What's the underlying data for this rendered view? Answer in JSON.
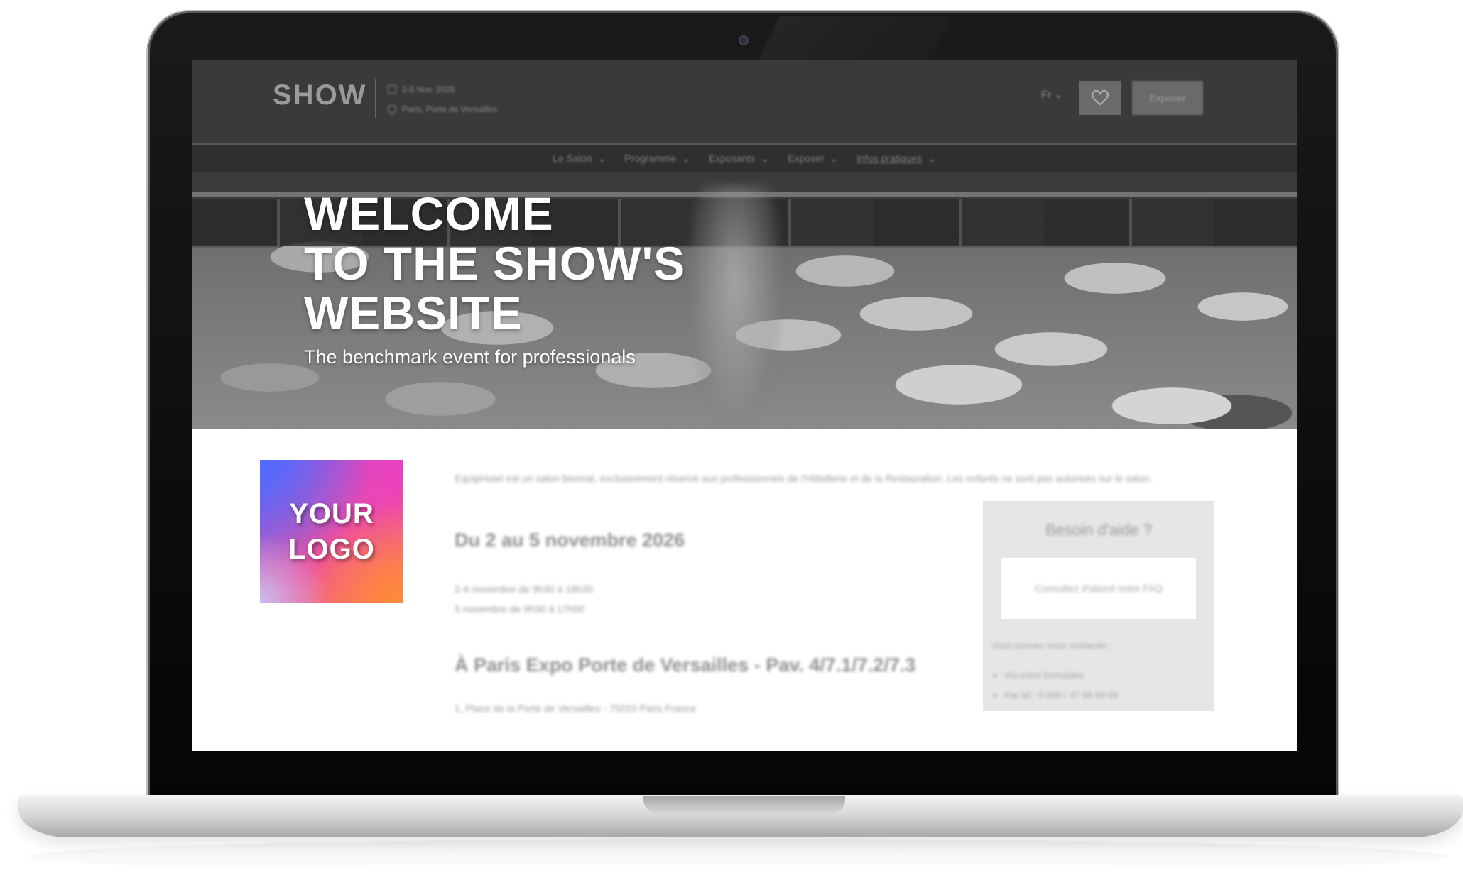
{
  "site": {
    "brand": "SHOW",
    "event_dates": "2-5 Nov. 2026",
    "event_location": "Paris, Porte de Versailles",
    "language": "Fr",
    "exhibit_button": "Exposer"
  },
  "nav": {
    "items": [
      {
        "label": "Le Salon"
      },
      {
        "label": "Programme"
      },
      {
        "label": "Exposants"
      },
      {
        "label": "Exposer"
      },
      {
        "label": "Infos pratiques"
      }
    ]
  },
  "hero": {
    "title_line1": "WELCOME",
    "title_line2": "TO THE SHOW'S",
    "title_line3": "WEBSITE",
    "subtitle": "The benchmark event for professionals"
  },
  "logo": {
    "line1": "YOUR",
    "line2": "LOGO"
  },
  "content": {
    "intro": "EquipHotel est un salon biennal, exclusivement réservé aux professionnels de l'Hôtellerie et de la Restauration. Les enfants ne sont pas autorisés sur le salon.",
    "dates_title": "Du 2 au 5 novembre 2026",
    "hours_line1": "2-4 novembre de 9h30 à 18h30",
    "hours_line2": "5 novembre de 9h30 à 17h00",
    "venue_title": "À Paris Expo Porte de Versailles - Pav. 4/7.1/7.2/7.3",
    "address": "1, Place de la Porte de Versailles - 75015 Paris France"
  },
  "help": {
    "title": "Besoin d'aide ?",
    "faq": "Consultez d'abord notre FAQ",
    "contact_label": "Vous pouvez nous contacter :",
    "contact_form": "Via notre formulaire",
    "contact_phone": "Par tel : 0 800 / 47 98 89 09"
  },
  "icons": {
    "favorite": "heart-icon",
    "calendar": "calendar-icon",
    "location": "pin-icon",
    "dropdown": "chevron-down-icon",
    "webcam": "webcam"
  },
  "colors": {
    "header_bg": "#3a3a3a",
    "nav_bg": "#2f2f2f",
    "hero_text": "#ffffff",
    "logo_gradient_start": "#7a5cf0",
    "logo_gradient_mid": "#f0509a",
    "logo_gradient_end": "#ff7e4f",
    "help_box_bg": "#e6e6e6"
  }
}
